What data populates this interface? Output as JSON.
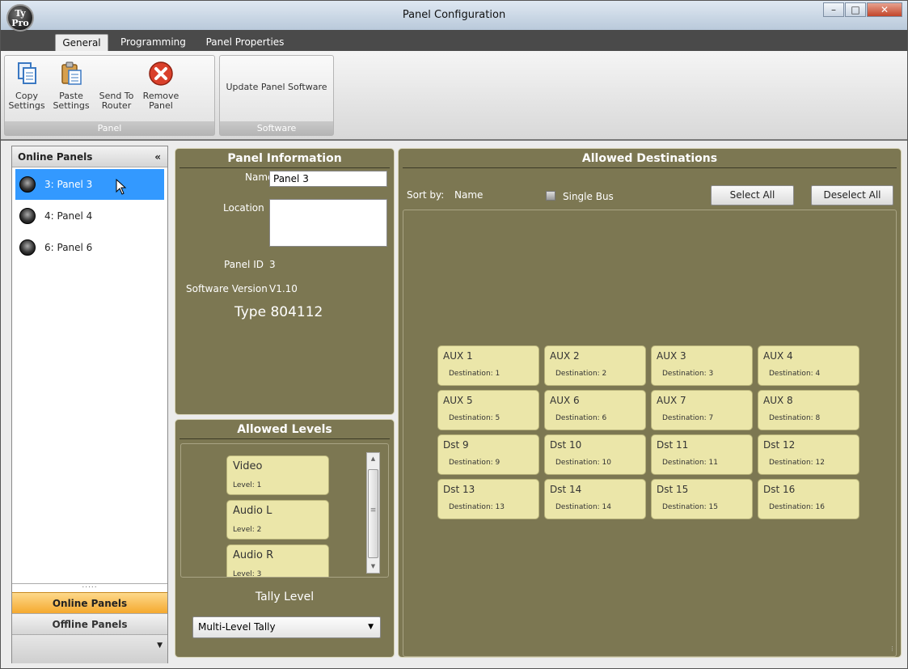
{
  "window": {
    "title": "Panel Configuration",
    "logo_text": "Ty Pro"
  },
  "tabs": [
    {
      "label": "General"
    },
    {
      "label": "Programming"
    },
    {
      "label": "Panel Properties"
    }
  ],
  "ribbon": {
    "panel_group": {
      "label": "Panel",
      "buttons": [
        {
          "label": "Copy Settings",
          "icon": "copy-icon"
        },
        {
          "label": "Paste Settings",
          "icon": "paste-icon"
        },
        {
          "label": "Send To Router",
          "icon": ""
        },
        {
          "label": "Remove Panel",
          "icon": "remove-icon"
        }
      ]
    },
    "software_group": {
      "label": "Software",
      "button": "Update Panel Software"
    }
  },
  "left_pane": {
    "header": "Online Panels",
    "collapse": "«",
    "panels": [
      {
        "label": "3: Panel 3",
        "selected": true
      },
      {
        "label": "4: Panel 4",
        "selected": false
      },
      {
        "label": "6: Panel 6",
        "selected": false
      }
    ],
    "splitter": ".....",
    "nav": {
      "online": "Online Panels",
      "offline": "Offline Panels"
    }
  },
  "panel_info": {
    "title": "Panel Information",
    "name_label": "Name",
    "name_value": "Panel 3",
    "location_label": "Location",
    "location_value": "",
    "panel_id_label": "Panel ID",
    "panel_id_value": "3",
    "software_version_label": "Software Version",
    "software_version_value": "V1.10",
    "type": "Type 804112"
  },
  "allowed_levels": {
    "title": "Allowed Levels",
    "levels": [
      {
        "name": "Video",
        "level": "Level: 1"
      },
      {
        "name": "Audio L",
        "level": "Level: 2"
      },
      {
        "name": "Audio R",
        "level": "Level: 3"
      }
    ],
    "tally_label": "Tally Level",
    "tally_value": "Multi-Level Tally"
  },
  "allowed_destinations": {
    "title": "Allowed Destinations",
    "sort_label": "Sort by:",
    "sort_value": "Name",
    "single_bus_label": "Single Bus",
    "single_bus_checked": false,
    "select_all": "Select All",
    "deselect_all": "Deselect All",
    "destinations": [
      {
        "name": "AUX 1",
        "dest": "Destination:  1"
      },
      {
        "name": "AUX 2",
        "dest": "Destination:  2"
      },
      {
        "name": "AUX 3",
        "dest": "Destination:  3"
      },
      {
        "name": "AUX 4",
        "dest": "Destination:  4"
      },
      {
        "name": "AUX 5",
        "dest": "Destination:  5"
      },
      {
        "name": "AUX 6",
        "dest": "Destination:  6"
      },
      {
        "name": "AUX 7",
        "dest": "Destination:  7"
      },
      {
        "name": "AUX 8",
        "dest": "Destination:  8"
      },
      {
        "name": "Dst 9",
        "dest": "Destination:  9"
      },
      {
        "name": "Dst 10",
        "dest": "Destination:  10"
      },
      {
        "name": "Dst 11",
        "dest": "Destination:  11"
      },
      {
        "name": "Dst 12",
        "dest": "Destination:  12"
      },
      {
        "name": "Dst 13",
        "dest": "Destination:  13"
      },
      {
        "name": "Dst 14",
        "dest": "Destination:  14"
      },
      {
        "name": "Dst 15",
        "dest": "Destination:  15"
      },
      {
        "name": "Dst 16",
        "dest": "Destination:  16"
      }
    ]
  },
  "colors": {
    "olive": "#7c7752",
    "card": "#ebe6a9",
    "selection": "#3399ff",
    "nav_active": "#f5a92f"
  }
}
